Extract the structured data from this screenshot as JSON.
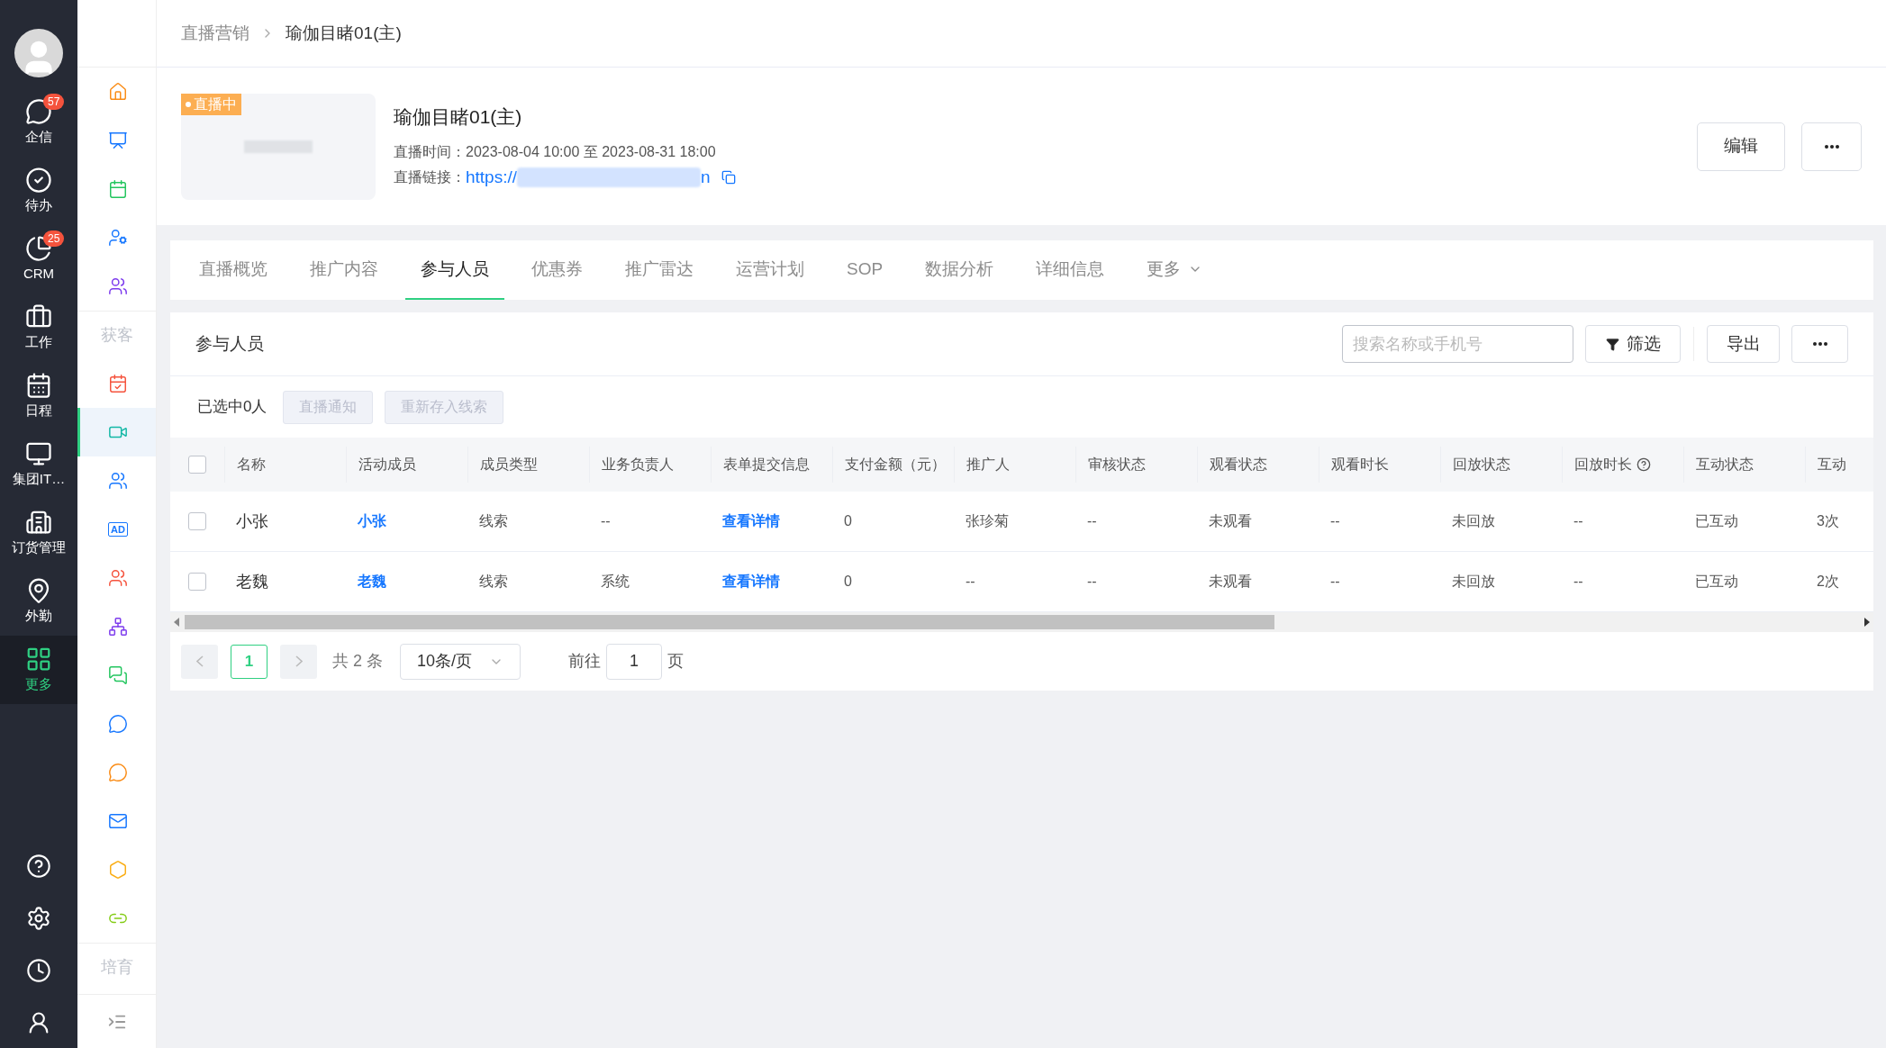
{
  "nav": {
    "items": [
      {
        "label": "企信",
        "badge": "57",
        "selected": false
      },
      {
        "label": "待办",
        "selected": false
      },
      {
        "label": "CRM",
        "badge": "25",
        "selected": false
      },
      {
        "label": "工作",
        "selected": false
      },
      {
        "label": "日程",
        "selected": false
      },
      {
        "label": "集团IT…",
        "selected": false
      },
      {
        "label": "订货管理",
        "selected": false
      },
      {
        "label": "外勤",
        "selected": false
      },
      {
        "label": "更多",
        "selected": true
      }
    ]
  },
  "subnav": [
    {
      "kind": "icon",
      "selected": false
    },
    {
      "kind": "icon",
      "selected": false
    },
    {
      "kind": "icon",
      "selected": false
    },
    {
      "kind": "icon",
      "selected": false
    },
    {
      "kind": "icon",
      "selected": false
    },
    {
      "kind": "section",
      "label": "获客"
    },
    {
      "kind": "icon",
      "selected": false
    },
    {
      "kind": "icon",
      "selected": true
    },
    {
      "kind": "icon",
      "selected": false
    },
    {
      "kind": "text_icon",
      "text": "AD",
      "selected": false
    },
    {
      "kind": "icon",
      "selected": false
    },
    {
      "kind": "icon",
      "selected": false
    },
    {
      "kind": "icon",
      "selected": false
    },
    {
      "kind": "icon",
      "selected": false
    },
    {
      "kind": "icon",
      "selected": false
    },
    {
      "kind": "icon",
      "selected": false
    },
    {
      "kind": "icon",
      "selected": false
    },
    {
      "kind": "icon",
      "selected": false
    },
    {
      "kind": "section",
      "label": "培育"
    }
  ],
  "breadcrumb": [
    "直播营销",
    "瑜伽目睹01(主)"
  ],
  "live": {
    "badge": "直播中",
    "title": "瑜伽目睹01(主)",
    "time_label": "直播时间：",
    "time": "2023-08-04 10:00 至 2023-08-31 18:00",
    "link_label": "直播链接：",
    "link_start": "https://",
    "link_end": "n",
    "buttons": [
      "编辑"
    ]
  },
  "tabs": [
    {
      "label": "直播概览",
      "selected": false
    },
    {
      "label": "推广内容",
      "selected": false
    },
    {
      "label": "参与人员",
      "selected": true
    },
    {
      "label": "优惠券",
      "selected": false
    },
    {
      "label": "推广雷达",
      "selected": false
    },
    {
      "label": "运营计划",
      "selected": false
    },
    {
      "label": "SOP",
      "selected": false
    },
    {
      "label": "数据分析",
      "selected": false
    },
    {
      "label": "详细信息",
      "selected": false
    },
    {
      "label": "更多",
      "selected": false
    }
  ],
  "panel": {
    "title": "参与人员",
    "search": {
      "placeholder": "搜索名称或手机号"
    },
    "filter": "筛选",
    "export": "导出",
    "selected_count": "已选中0人",
    "bulk_actions": [
      "直播通知",
      "重新存入线索"
    ]
  },
  "table": {
    "columns": [
      {
        "label": "名称",
        "kind": "text"
      },
      {
        "label": "活动成员",
        "kind": "link"
      },
      {
        "label": "成员类型",
        "kind": "text"
      },
      {
        "label": "业务负责人",
        "kind": "text"
      },
      {
        "label": "表单提交信息",
        "kind": "link"
      },
      {
        "label": "支付金额（元）",
        "kind": "text"
      },
      {
        "label": "推广人",
        "kind": "text"
      },
      {
        "label": "审核状态",
        "kind": "text"
      },
      {
        "label": "观看状态",
        "kind": "text"
      },
      {
        "label": "观看时长",
        "kind": "text"
      },
      {
        "label": "回放状态",
        "kind": "text"
      },
      {
        "label": "回放时长",
        "kind": "text",
        "help": true
      },
      {
        "label": "互动状态",
        "kind": "text"
      },
      {
        "label": "互动",
        "kind": "text"
      }
    ],
    "all_checked": false,
    "rows": [
      {
        "checked": false,
        "cells": [
          "小张",
          "小张",
          "线索",
          "--",
          "查看详情",
          "0",
          "张珍菊",
          "--",
          "未观看",
          "--",
          "未回放",
          "--",
          "已互动",
          "3次"
        ]
      },
      {
        "checked": false,
        "cells": [
          "老魏",
          "老魏",
          "线索",
          "系统",
          "查看详情",
          "0",
          "--",
          "--",
          "未观看",
          "--",
          "未回放",
          "--",
          "已互动",
          "2次"
        ]
      }
    ]
  },
  "pagination": {
    "pages": [
      {
        "label": "1",
        "selected": true
      }
    ],
    "total": "共 2 条",
    "page_size": "10条/页",
    "goto_label": "前往",
    "goto_value": "1",
    "goto_suffix": "页"
  }
}
